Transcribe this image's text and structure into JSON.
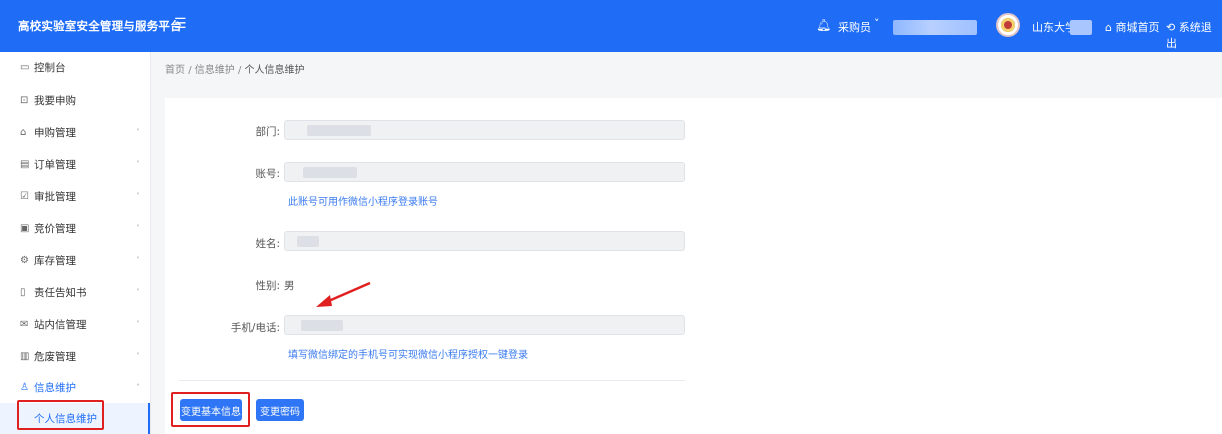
{
  "header": {
    "brand": "高校实验室安全管理与服务平台",
    "menu_toggle_icon": "menu-fold-icon",
    "role": "采购员",
    "school": "山东大学-",
    "home_link": "商城首页",
    "logout_link": "系统退出"
  },
  "sidebar": {
    "items": [
      {
        "icon": "▭",
        "label": "控制台"
      },
      {
        "icon": "⊡",
        "label": "我要申购"
      },
      {
        "icon": "⌂",
        "label": "申购管理",
        "caret": "˅"
      },
      {
        "icon": "▤",
        "label": "订单管理",
        "caret": "˅"
      },
      {
        "icon": "☑",
        "label": "审批管理",
        "caret": "˅"
      },
      {
        "icon": "▣",
        "label": "竞价管理",
        "caret": "˅"
      },
      {
        "icon": "⚙",
        "label": "库存管理",
        "caret": "˅"
      },
      {
        "icon": "▯",
        "label": "责任告知书",
        "caret": "˅"
      },
      {
        "icon": "✉",
        "label": "站内信管理",
        "caret": "˅"
      },
      {
        "icon": "▥",
        "label": "危废管理",
        "caret": "˅"
      },
      {
        "icon": "♙",
        "label": "信息维护",
        "caret": "˄"
      }
    ],
    "sub_item": "个人信息维护"
  },
  "breadcrumb": {
    "home": "首页",
    "parent": "信息维护",
    "current": "个人信息维护",
    "separator": "/"
  },
  "form": {
    "department_label": "部门:",
    "account_label": "账号:",
    "account_hint": "此账号可用作微信小程序登录账号",
    "name_label": "姓名:",
    "gender_label": "性别:",
    "gender_value": "男",
    "phone_label": "手机/电话:",
    "phone_hint": "填写微信绑定的手机号可实现微信小程序授权一键登录"
  },
  "buttons": {
    "change_info": "变更基本信息",
    "change_password": "变更密码"
  },
  "colors": {
    "primary": "#1f6df6",
    "annotation": "#e02020"
  }
}
